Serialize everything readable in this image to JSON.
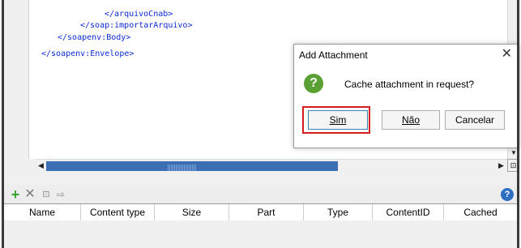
{
  "editor": {
    "code_lines": [
      "</arquivoCnab>",
      "</soap:importarArquivo>",
      "</soapenv:Body>",
      "</soapenv:Envelope>"
    ],
    "hscroll_position": 0.65
  },
  "dialog": {
    "title": "Add Attachment",
    "close_glyph": "✕",
    "message": "Cache attachment in request?",
    "buttons": {
      "sim": "Sim",
      "nao": "Não",
      "cancelar": "Cancelar"
    }
  },
  "attachments": {
    "toolbar": {
      "add_icon": "plus-icon",
      "remove_icon": "delete-icon",
      "edit_icon": "edit-icon",
      "export_icon": "export-icon",
      "help_icon": "help-icon"
    },
    "columns": [
      "Name",
      "Content type",
      "Size",
      "Part",
      "Type",
      "ContentID",
      "Cached"
    ]
  },
  "colors": {
    "code": "#0a2bd6",
    "scroll_thumb": "#3c6eb4",
    "highlight": "#d21e1e",
    "add": "#3aa52e",
    "help": "#2d6fc1",
    "question": "#5aa032"
  }
}
